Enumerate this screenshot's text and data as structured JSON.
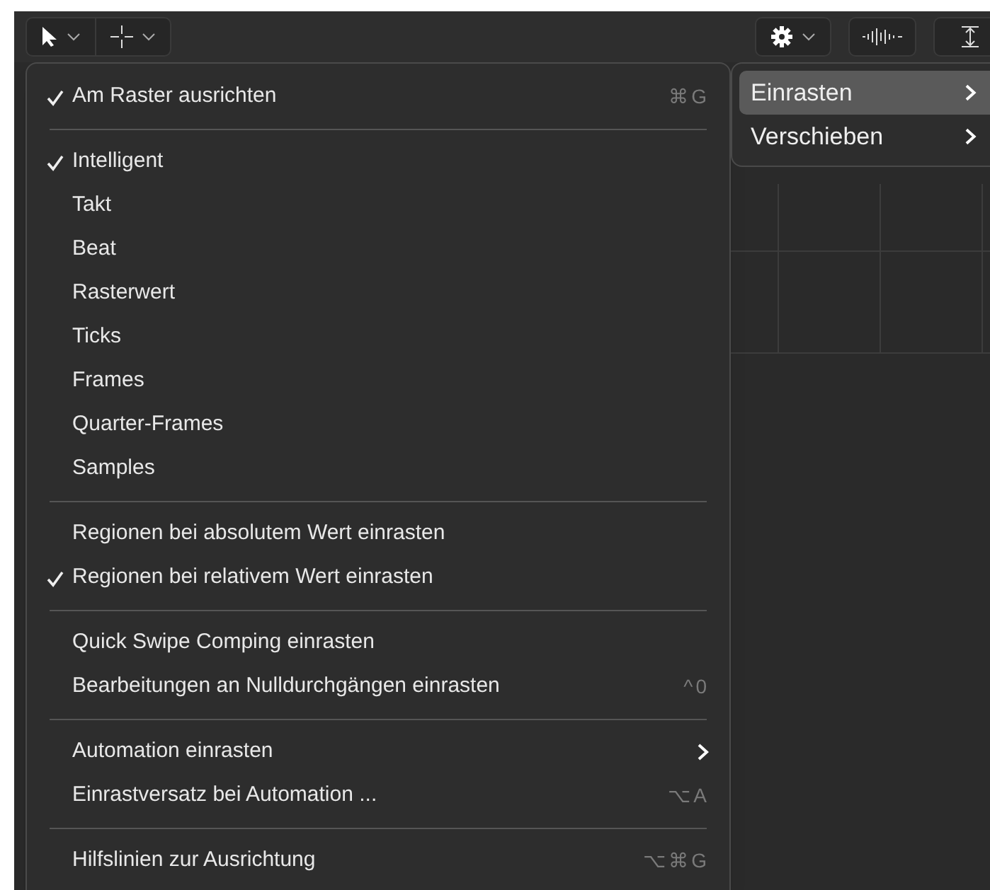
{
  "menu": {
    "sections": [
      [
        {
          "label": "Am Raster ausrichten",
          "checked": true,
          "shortcut": "⌘G",
          "has_submenu": false
        }
      ],
      [
        {
          "label": "Intelligent",
          "checked": true,
          "has_submenu": false
        },
        {
          "label": "Takt",
          "checked": false,
          "has_submenu": false
        },
        {
          "label": "Beat",
          "checked": false,
          "has_submenu": false
        },
        {
          "label": "Rasterwert",
          "checked": false,
          "has_submenu": false
        },
        {
          "label": "Ticks",
          "checked": false,
          "has_submenu": false
        },
        {
          "label": "Frames",
          "checked": false,
          "has_submenu": false
        },
        {
          "label": "Quarter-Frames",
          "checked": false,
          "has_submenu": false
        },
        {
          "label": "Samples",
          "checked": false,
          "has_submenu": false
        }
      ],
      [
        {
          "label": "Regionen bei absolutem Wert einrasten",
          "checked": false,
          "has_submenu": false
        },
        {
          "label": "Regionen bei relativem Wert einrasten",
          "checked": true,
          "has_submenu": false
        }
      ],
      [
        {
          "label": "Quick Swipe Comping einrasten",
          "checked": false,
          "has_submenu": false
        },
        {
          "label": "Bearbeitungen an Nulldurchgängen einrasten",
          "checked": false,
          "shortcut": "^0",
          "has_submenu": false
        }
      ],
      [
        {
          "label": "Automation einrasten",
          "checked": false,
          "has_submenu": true
        },
        {
          "label": "Einrastversatz bei Automation ...",
          "checked": false,
          "shortcut": "⌥A",
          "has_submenu": false
        }
      ],
      [
        {
          "label": "Hilfslinien zur Ausrichtung",
          "checked": false,
          "shortcut": "⌥⌘G",
          "has_submenu": false
        }
      ]
    ]
  },
  "submenu": [
    {
      "label": "Einrasten",
      "selected": true
    },
    {
      "label": "Verschieben",
      "selected": false
    }
  ]
}
